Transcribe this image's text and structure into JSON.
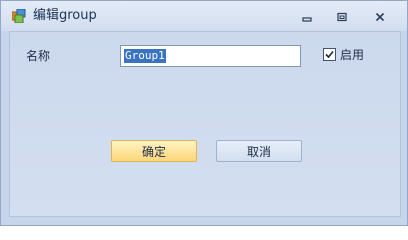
{
  "window": {
    "title": "编辑group"
  },
  "form": {
    "name_label": "名称",
    "name_value": "Group1",
    "enabled_label": "启用",
    "enabled_checked": true
  },
  "buttons": {
    "ok_label": "确定",
    "cancel_label": "取消"
  },
  "icons": {
    "app": "app-window-icon",
    "minimize": "minimize-icon",
    "maximize": "maximize-icon",
    "close": "close-icon",
    "check": "checkmark-icon"
  },
  "colors": {
    "window_bg": "#c6d5ea",
    "selection": "#3a73c4",
    "ok_button": "#fbd77a"
  }
}
